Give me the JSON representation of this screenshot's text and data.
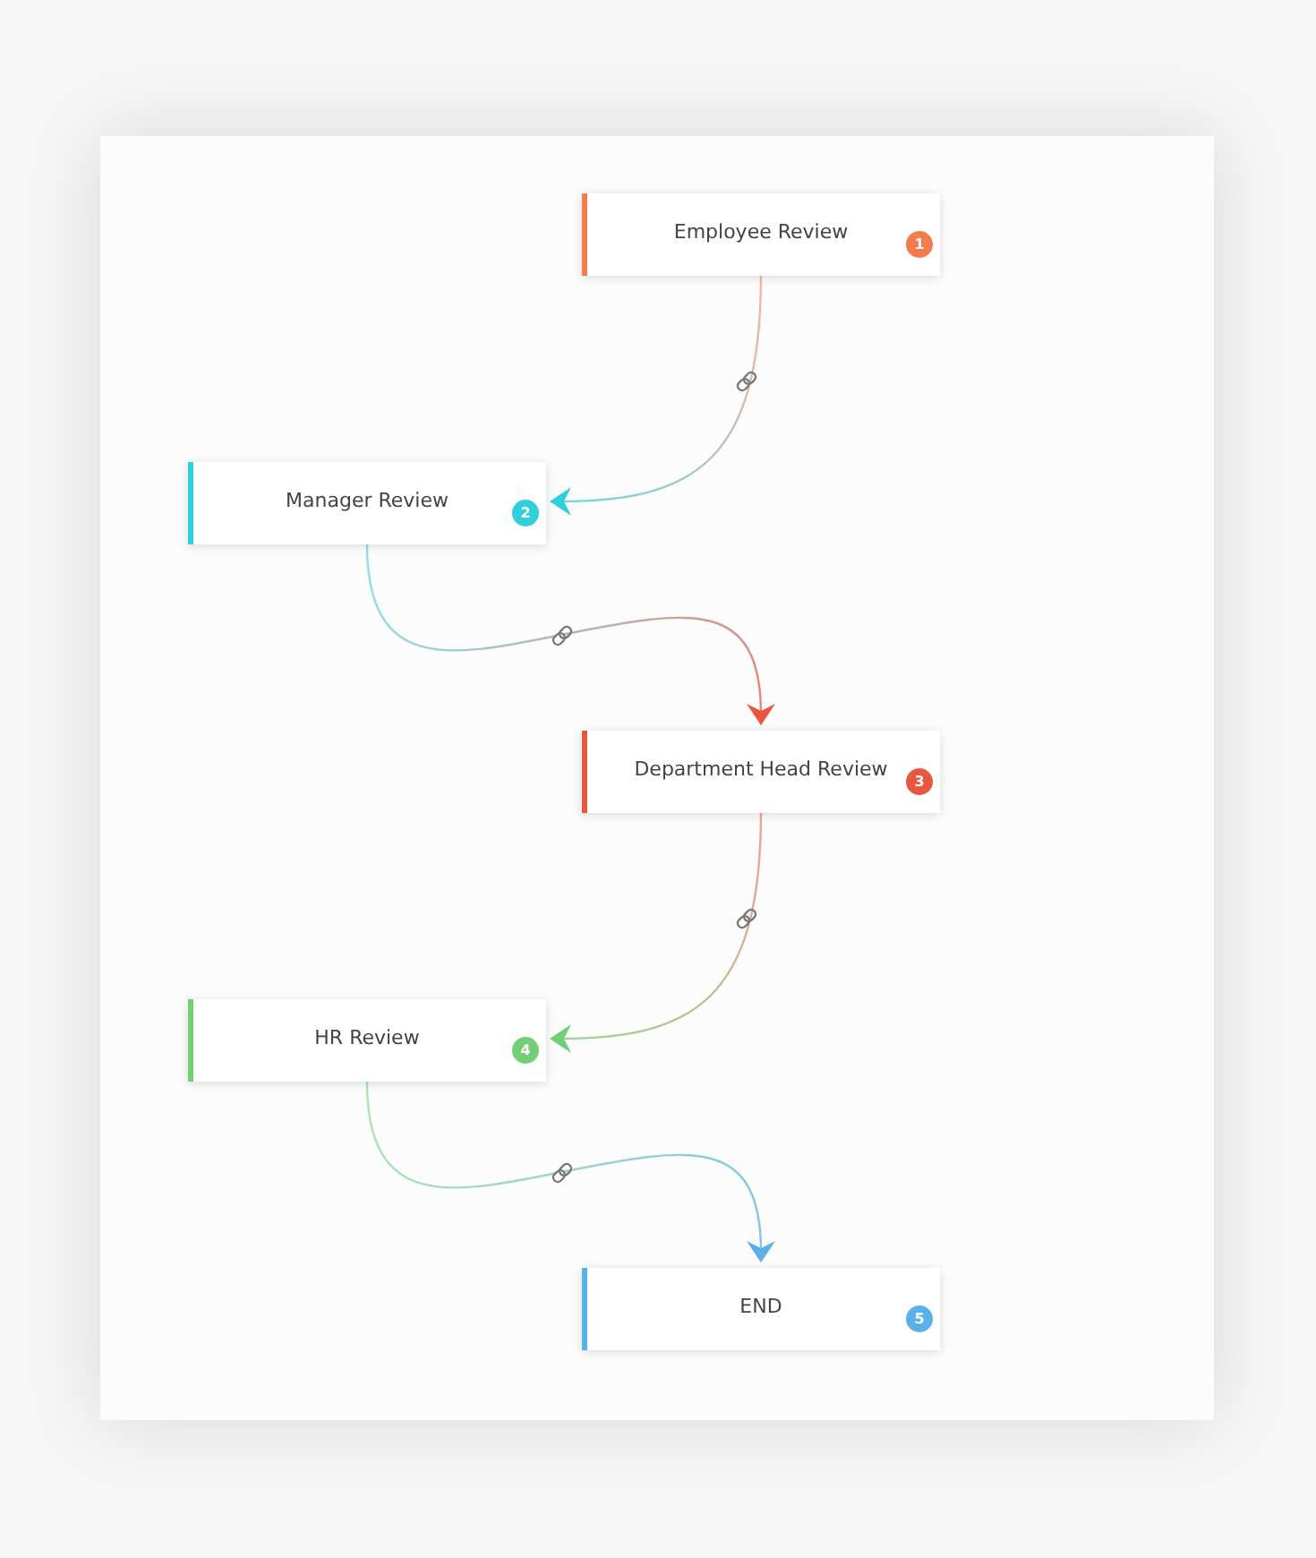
{
  "workflow": {
    "nodes": [
      {
        "label": "Employee Review",
        "number": "1",
        "color": "#f47b4b"
      },
      {
        "label": "Manager Review",
        "number": "2",
        "color": "#2fd0dc"
      },
      {
        "label": "Department Head Review",
        "number": "3",
        "color": "#e8583f"
      },
      {
        "label": "HR Review",
        "number": "4",
        "color": "#72cf78"
      },
      {
        "label": "END",
        "number": "5",
        "color": "#5ab0e8"
      }
    ]
  }
}
